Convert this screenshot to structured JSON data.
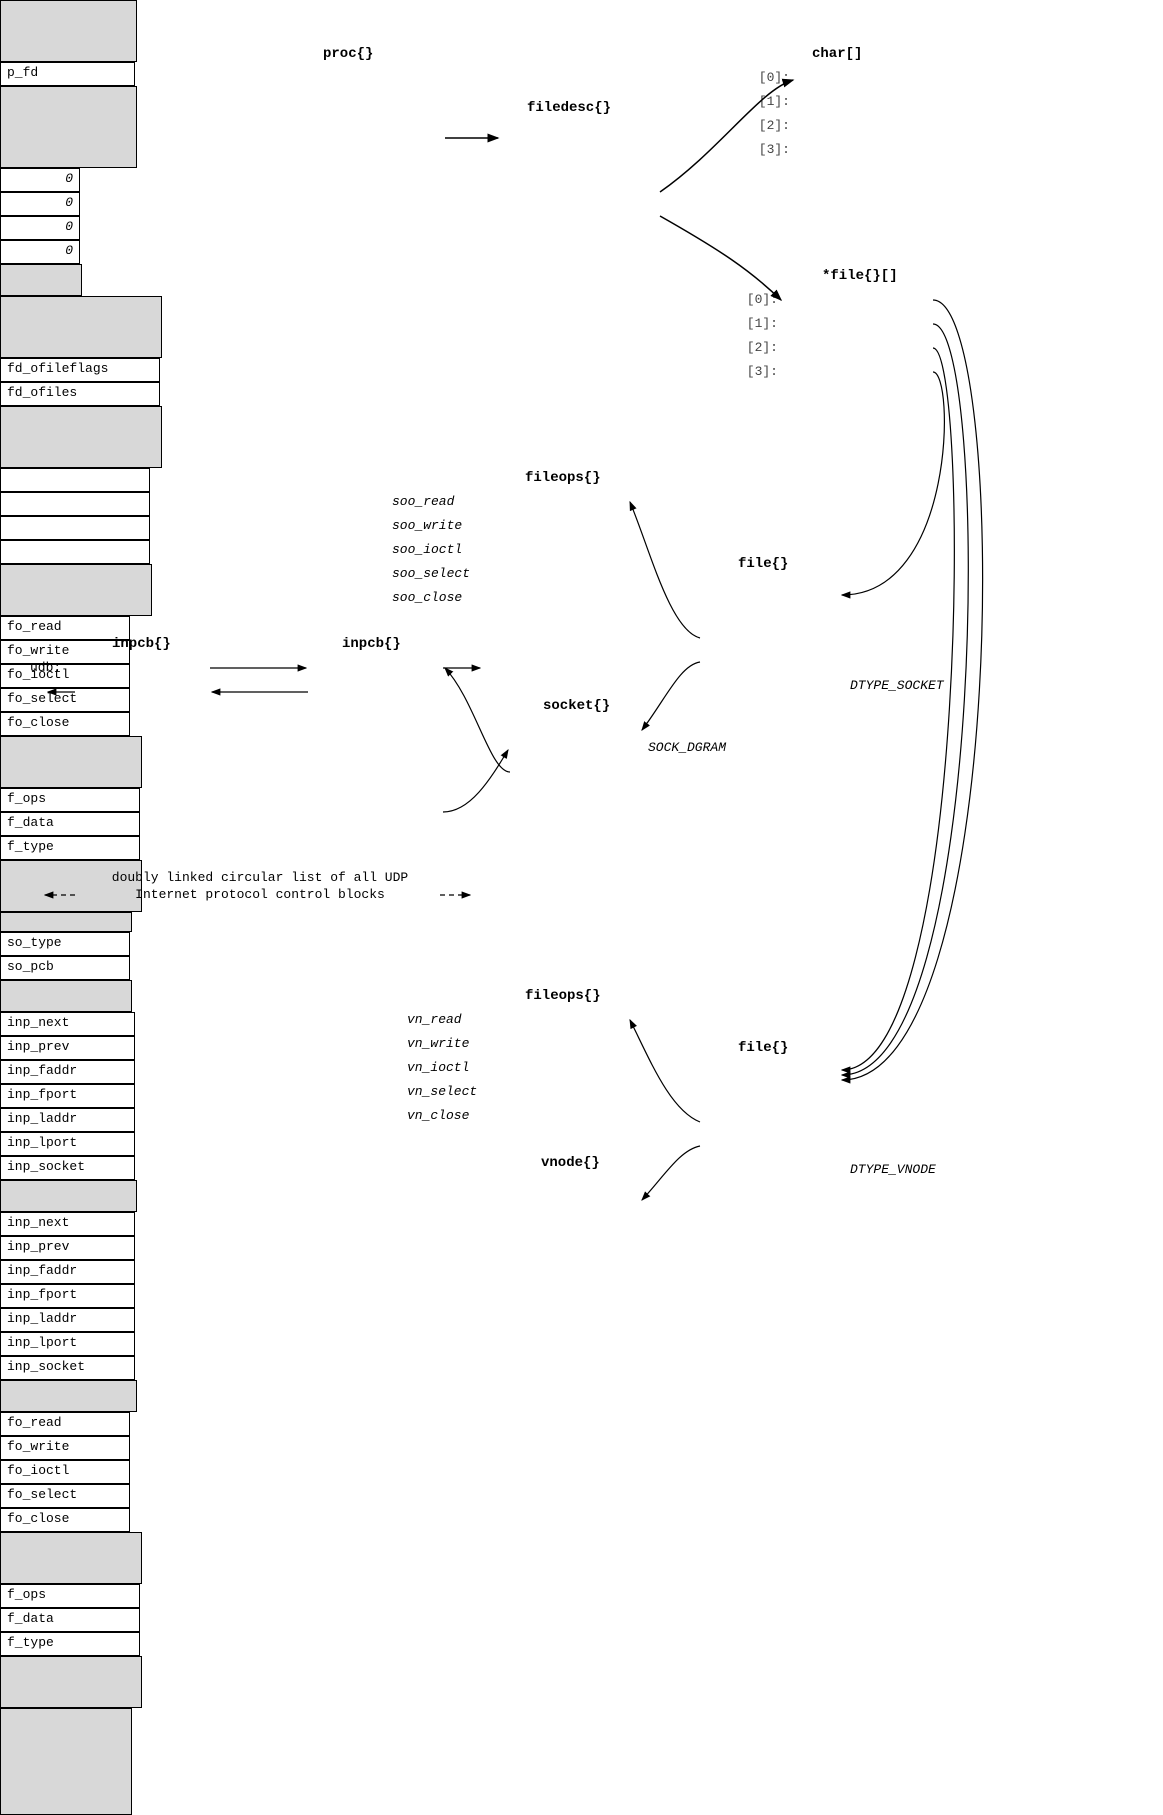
{
  "proc": {
    "title": "proc{}",
    "row": "p_fd"
  },
  "filedesc": {
    "title": "filedesc{}",
    "rows": [
      "fd_ofileflags",
      "fd_ofiles"
    ]
  },
  "char_arr": {
    "title": "char[]",
    "idx": [
      "[0]:",
      "[1]:",
      "[2]:",
      "[3]:"
    ],
    "vals": [
      "0",
      "0",
      "0",
      "0"
    ]
  },
  "file_arr": {
    "title": "*file{}[]",
    "idx": [
      "[0]:",
      "[1]:",
      "[2]:",
      "[3]:"
    ]
  },
  "fileops1": {
    "title": "fileops{}",
    "rows": [
      "fo_read",
      "fo_write",
      "fo_ioctl",
      "fo_select",
      "fo_close"
    ],
    "labels": [
      "soo_read",
      "soo_write",
      "soo_ioctl",
      "soo_select",
      "soo_close"
    ]
  },
  "fileops2": {
    "title": "fileops{}",
    "rows": [
      "fo_read",
      "fo_write",
      "fo_ioctl",
      "fo_select",
      "fo_close"
    ],
    "labels": [
      "vn_read",
      "vn_write",
      "vn_ioctl",
      "vn_select",
      "vn_close"
    ]
  },
  "file1": {
    "title": "file{}",
    "rows": [
      "f_ops",
      "f_data",
      "f_type"
    ],
    "annot": "DTYPE_SOCKET"
  },
  "file2": {
    "title": "file{}",
    "rows": [
      "f_ops",
      "f_data",
      "f_type"
    ],
    "annot": "DTYPE_VNODE"
  },
  "socket": {
    "title": "socket{}",
    "rows": [
      "so_type",
      "so_pcb"
    ],
    "annot": "SOCK_DGRAM"
  },
  "vnode": {
    "title": "vnode{}"
  },
  "inpcb1": {
    "title": "inpcb{}",
    "rows": [
      "inp_next",
      "inp_prev",
      "inp_faddr",
      "inp_fport",
      "inp_laddr",
      "inp_lport",
      "inp_socket"
    ],
    "udb": "udb:"
  },
  "inpcb2": {
    "title": "inpcb{}",
    "rows": [
      "inp_next",
      "inp_prev",
      "inp_faddr",
      "inp_fport",
      "inp_laddr",
      "inp_lport",
      "inp_socket"
    ]
  },
  "caption": "doubly linked circular list of all UDP\nInternet protocol control blocks"
}
